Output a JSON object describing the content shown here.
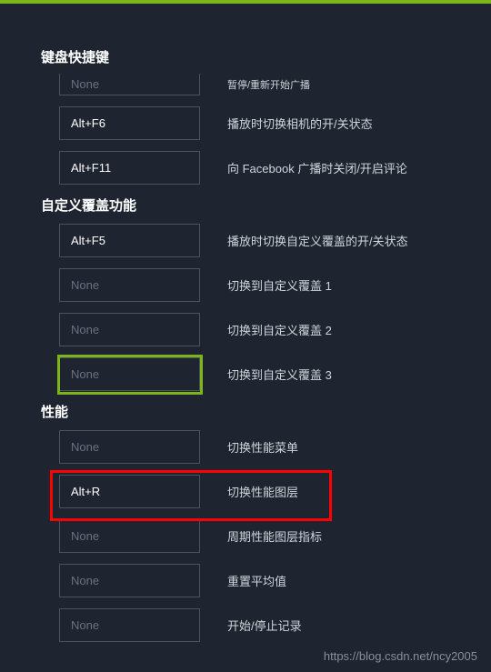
{
  "topbar_color": "#7cb518",
  "sections": {
    "keyboard": {
      "title": "键盘快捷键",
      "rows": [
        {
          "value": "None",
          "filled": false,
          "label": "暂停/重新开始广播"
        },
        {
          "value": "Alt+F6",
          "filled": true,
          "label": "播放时切换相机的开/关状态"
        },
        {
          "value": "Alt+F11",
          "filled": true,
          "label": "向 Facebook 广播时关闭/开启评论"
        }
      ]
    },
    "custom_overlay": {
      "title": "自定义覆盖功能",
      "rows": [
        {
          "value": "Alt+F5",
          "filled": true,
          "label": "播放时切换自定义覆盖的开/关状态"
        },
        {
          "value": "None",
          "filled": false,
          "label": "切换到自定义覆盖 1"
        },
        {
          "value": "None",
          "filled": false,
          "label": "切换到自定义覆盖 2"
        },
        {
          "value": "None",
          "filled": false,
          "label": "切换到自定义覆盖 3",
          "highlight_green": true
        }
      ]
    },
    "performance": {
      "title": "性能",
      "rows": [
        {
          "value": "None",
          "filled": false,
          "label": "切换性能菜单"
        },
        {
          "value": "Alt+R",
          "filled": true,
          "label": "切换性能图层",
          "highlight_red": true
        },
        {
          "value": "None",
          "filled": false,
          "label": "周期性能图层指标"
        },
        {
          "value": "None",
          "filled": false,
          "label": "重置平均值"
        },
        {
          "value": "None",
          "filled": false,
          "label": "开始/停止记录"
        }
      ]
    }
  },
  "watermark": "https://blog.csdn.net/ncy2005"
}
